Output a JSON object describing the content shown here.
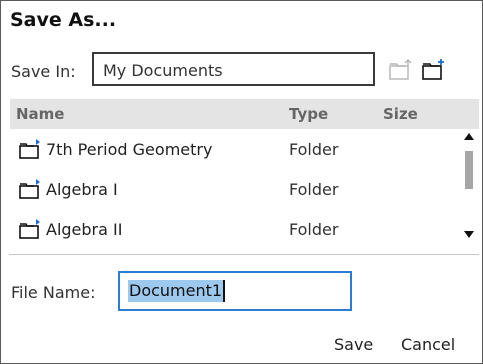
{
  "dialog": {
    "title": "Save As...",
    "save_in_label": "Save In:",
    "save_in_value": "My Documents"
  },
  "toolbar": {
    "up_folder_icon": "folder-up-icon",
    "new_folder_icon": "new-folder-icon"
  },
  "file_list": {
    "columns": [
      "Name",
      "Type",
      "Size"
    ],
    "rows": [
      {
        "name": "7th Period Geometry",
        "type": "Folder",
        "size": "",
        "icon": "folder-icon"
      },
      {
        "name": "Algebra I",
        "type": "Folder",
        "size": "",
        "icon": "folder-icon"
      },
      {
        "name": "Algebra II",
        "type": "Folder",
        "size": "",
        "icon": "folder-icon"
      }
    ]
  },
  "file_name": {
    "label": "File Name:",
    "value": "Document1"
  },
  "buttons": {
    "save": "Save",
    "cancel": "Cancel"
  },
  "colors": {
    "focus_border": "#2b7cd3",
    "selection": "#9dc9ee",
    "folder_badge": "#1a6fd8",
    "header_bg": "#e4e4e4"
  }
}
